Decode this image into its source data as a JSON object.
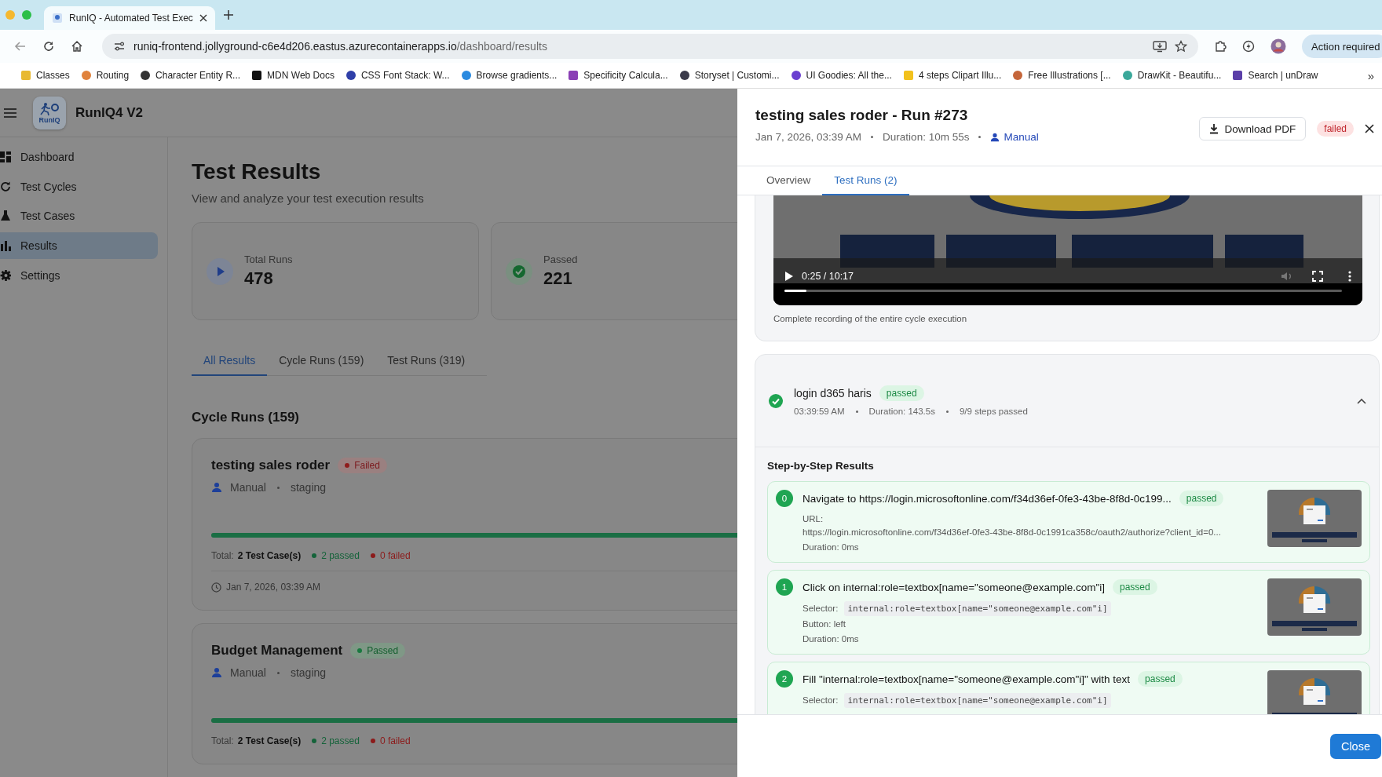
{
  "browser": {
    "tabs": [
      {
        "title": "RunIQ - Automated Test Exec",
        "selected": true
      }
    ],
    "address": {
      "host": "runiq-frontend.jollyground-c6e4d206.eastus.azurecontainerapps.io",
      "path": "/dashboard/results"
    },
    "profile_button": "Action required",
    "bookmarks": [
      {
        "label": "Classes",
        "color": "#e8b931"
      },
      {
        "label": "Routing",
        "color": "#e0823c"
      },
      {
        "label": "Character Entity R...",
        "color": "#333333"
      },
      {
        "label": "MDN Web Docs",
        "color": "#111111"
      },
      {
        "label": "CSS Font Stack: W...",
        "color": "#2f3fa8"
      },
      {
        "label": "Browse gradients...",
        "color": "#2a8ae0"
      },
      {
        "label": "Specificity Calcula...",
        "color": "#8a3fb5"
      },
      {
        "label": "Storyset | Customi...",
        "color": "#3a3a4a"
      },
      {
        "label": "UI Goodies: All the...",
        "color": "#6a3fd0"
      },
      {
        "label": "4 steps Clipart Illu...",
        "color": "#f2c11c"
      },
      {
        "label": "Free Illustrations [...",
        "color": "#c5663a"
      },
      {
        "label": "DrawKit - Beautifu...",
        "color": "#3aa89a"
      },
      {
        "label": "Search | unDraw",
        "color": "#5b3fa8"
      }
    ],
    "bookmarks_more": "»"
  },
  "app": {
    "name": "RunIQ4 V2",
    "logo_text": "RunIQ",
    "nav": [
      {
        "label": "Dashboard",
        "selected": false
      },
      {
        "label": "Test Cycles",
        "selected": false
      },
      {
        "label": "Test Cases",
        "selected": false
      },
      {
        "label": "Results",
        "selected": true
      },
      {
        "label": "Settings",
        "selected": false
      }
    ],
    "page": {
      "title": "Test Results",
      "subtitle": "View and analyze your test execution results",
      "stats": [
        {
          "kind": "total",
          "label": "Total Runs",
          "value": "478"
        },
        {
          "kind": "passed",
          "label": "Passed",
          "value": "221"
        }
      ],
      "tabs": [
        {
          "label": "All Results",
          "selected": true
        },
        {
          "label": "Cycle Runs (159)",
          "selected": false
        },
        {
          "label": "Test Runs (319)",
          "selected": false
        }
      ],
      "section_title": "Cycle Runs (159)",
      "cycle_runs": [
        {
          "name": "testing sales roder",
          "status": {
            "kind": "failed",
            "label": "Failed"
          },
          "trigger": "Manual",
          "environment": "staging",
          "level": 1,
          "total_label": "Total:",
          "total_value": "2 Test Case(s)",
          "passed": "2 passed",
          "failed": "0 failed",
          "date": "Jan 7, 2026, 03:39 AM"
        },
        {
          "name": "Budget Management",
          "status": {
            "kind": "passed",
            "label": "Passed"
          },
          "trigger": "Manual",
          "environment": "staging",
          "level": 1,
          "total_label": "Total:",
          "total_value": "2 Test Case(s)",
          "passed": "2 passed",
          "failed": "0 failed"
        }
      ]
    }
  },
  "panel": {
    "title": "testing sales roder - Run #273",
    "date": "Jan 7, 2026, 03:39 AM",
    "duration": "Duration: 10m 55s",
    "trigger": "Manual",
    "download_button": "Download PDF",
    "status": {
      "kind": "failed",
      "label": "failed"
    },
    "tabs": [
      {
        "label": "Overview",
        "selected": false
      },
      {
        "label": "Test Runs (2)",
        "selected": true
      }
    ],
    "video": {
      "time": "0:25 / 10:17",
      "level": 0.04,
      "caption": "Complete recording of the entire cycle execution"
    },
    "test_run": {
      "name": "login d365 haris",
      "status": {
        "kind": "passed",
        "label": "passed"
      },
      "time": "03:39:59 AM",
      "duration": "Duration: 143.5s",
      "steps_summary": "9/9 steps passed",
      "expanded": true,
      "steps_title": "Step-by-Step Results",
      "steps": [
        {
          "number": "0",
          "title": "Navigate to https://login.microsoftonline.com/f34d36ef-0fe3-43be-8f8d-0c199...",
          "status": {
            "kind": "passed",
            "label": "passed"
          },
          "details": [
            {
              "kind": "block",
              "label": "URL:",
              "value": "https://login.microsoftonline.com/f34d36ef-0fe3-43be-8f8d-0c1991ca358c/oauth2/authorize?client_id=0..."
            },
            {
              "kind": "text",
              "text": "Duration: 0ms"
            }
          ]
        },
        {
          "number": "1",
          "title": "Click on internal:role=textbox[name=\"someone@example.com\"i]",
          "status": {
            "kind": "passed",
            "label": "passed"
          },
          "details": [
            {
              "kind": "code",
              "label": "Selector:",
              "value": "internal:role=textbox[name=\"someone@example.com\"i]"
            },
            {
              "kind": "text",
              "text": "Button: left"
            },
            {
              "kind": "text",
              "text": "Duration: 0ms"
            }
          ]
        },
        {
          "number": "2",
          "title": "Fill \"internal:role=textbox[name=\"someone@example.com\"i]\" with text",
          "status": {
            "kind": "passed",
            "label": "passed"
          },
          "details": [
            {
              "kind": "code",
              "label": "Selector:",
              "value": "internal:role=textbox[name=\"someone@example.com\"i]"
            }
          ]
        }
      ]
    },
    "close_button": "Close"
  }
}
